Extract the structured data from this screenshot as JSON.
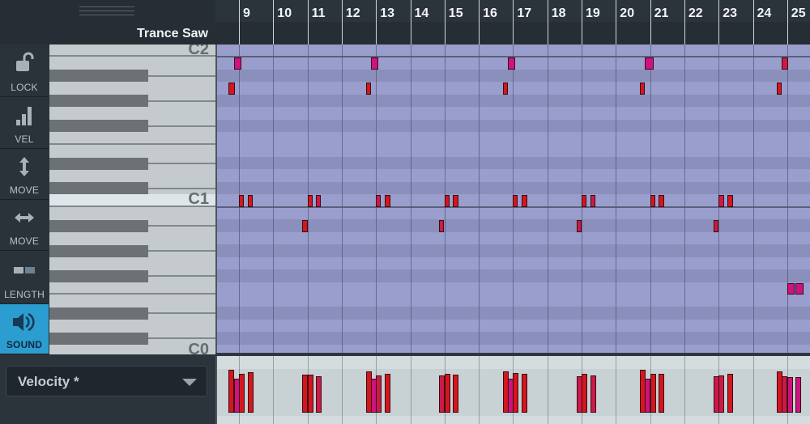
{
  "track": {
    "title": "Trance Saw"
  },
  "tools": [
    {
      "id": "lock",
      "label": "LOCK",
      "icon": "unlock-icon",
      "active": false
    },
    {
      "id": "vel",
      "label": "VEL",
      "icon": "velocity-bars-icon",
      "active": false
    },
    {
      "id": "move-v",
      "label": "MOVE",
      "icon": "vertical-arrows-icon",
      "active": false
    },
    {
      "id": "move-h",
      "label": "MOVE",
      "icon": "horizontal-arrows-icon",
      "active": false
    },
    {
      "id": "length",
      "label": "LENGTH",
      "icon": "length-icon",
      "active": false
    },
    {
      "id": "sound",
      "label": "SOUND",
      "icon": "speaker-icon",
      "active": true
    }
  ],
  "piano": {
    "octave_labels": [
      "C2",
      "C1",
      "C0"
    ]
  },
  "ruler": {
    "beats": [
      "9",
      "10",
      "11",
      "12",
      "13",
      "14",
      "15",
      "16",
      "17",
      "18",
      "19",
      "20",
      "21",
      "22",
      "23",
      "24",
      "25"
    ]
  },
  "lane_selector": {
    "value": "Velocity *"
  },
  "colors": {
    "accent": "#2b9dd0",
    "note_red": "#d4161d",
    "note_crimson": "#cc1a48",
    "note_magenta": "#cc1380",
    "grid_light": "#9a9ecd",
    "grid_dark": "#8b8fbb"
  },
  "notes": [
    {
      "beat": 8.85,
      "len": 0.22,
      "pitch": "B1",
      "color": "note_magenta",
      "vel": 0.7
    },
    {
      "beat": 8.7,
      "len": 0.18,
      "pitch": "A1",
      "color": "note_red",
      "vel": 0.88
    },
    {
      "beat": 9.0,
      "len": 0.14,
      "pitch": "C1",
      "color": "note_red",
      "vel": 0.8
    },
    {
      "beat": 9.25,
      "len": 0.16,
      "pitch": "C1",
      "color": "note_red",
      "vel": 0.83
    },
    {
      "beat": 10.85,
      "len": 0.16,
      "pitch": "A#0",
      "color": "note_red",
      "vel": 0.78
    },
    {
      "beat": 11.0,
      "len": 0.14,
      "pitch": "C1",
      "color": "note_red",
      "vel": 0.78
    },
    {
      "beat": 11.25,
      "len": 0.14,
      "pitch": "C1",
      "color": "note_crimson",
      "vel": 0.75
    },
    {
      "beat": 12.85,
      "len": 0.22,
      "pitch": "B1",
      "color": "note_magenta",
      "vel": 0.7
    },
    {
      "beat": 12.7,
      "len": 0.14,
      "pitch": "A1",
      "color": "note_red",
      "vel": 0.85
    },
    {
      "beat": 13.0,
      "len": 0.14,
      "pitch": "C1",
      "color": "note_crimson",
      "vel": 0.76
    },
    {
      "beat": 13.25,
      "len": 0.16,
      "pitch": "C1",
      "color": "note_red",
      "vel": 0.8
    },
    {
      "beat": 14.85,
      "len": 0.14,
      "pitch": "A#0",
      "color": "note_crimson",
      "vel": 0.76
    },
    {
      "beat": 15.0,
      "len": 0.14,
      "pitch": "C1",
      "color": "note_red",
      "vel": 0.8
    },
    {
      "beat": 15.25,
      "len": 0.16,
      "pitch": "C1",
      "color": "note_red",
      "vel": 0.78
    },
    {
      "beat": 16.85,
      "len": 0.2,
      "pitch": "B1",
      "color": "note_magenta",
      "vel": 0.7
    },
    {
      "beat": 16.7,
      "len": 0.12,
      "pitch": "A1",
      "color": "note_red",
      "vel": 0.85
    },
    {
      "beat": 17.0,
      "len": 0.14,
      "pitch": "C1",
      "color": "note_red",
      "vel": 0.82
    },
    {
      "beat": 17.25,
      "len": 0.16,
      "pitch": "C1",
      "color": "note_red",
      "vel": 0.8
    },
    {
      "beat": 18.85,
      "len": 0.12,
      "pitch": "A#0",
      "color": "note_crimson",
      "vel": 0.75
    },
    {
      "beat": 19.0,
      "len": 0.14,
      "pitch": "C1",
      "color": "note_red",
      "vel": 0.8
    },
    {
      "beat": 19.25,
      "len": 0.14,
      "pitch": "C1",
      "color": "note_crimson",
      "vel": 0.77
    },
    {
      "beat": 20.85,
      "len": 0.26,
      "pitch": "B1",
      "color": "note_magenta",
      "vel": 0.7
    },
    {
      "beat": 20.7,
      "len": 0.14,
      "pitch": "A1",
      "color": "note_red",
      "vel": 0.88
    },
    {
      "beat": 21.0,
      "len": 0.14,
      "pitch": "C1",
      "color": "note_red",
      "vel": 0.8
    },
    {
      "beat": 21.25,
      "len": 0.16,
      "pitch": "C1",
      "color": "note_red",
      "vel": 0.8
    },
    {
      "beat": 22.85,
      "len": 0.12,
      "pitch": "A#0",
      "color": "note_crimson",
      "vel": 0.75
    },
    {
      "beat": 23.0,
      "len": 0.16,
      "pitch": "C1",
      "color": "note_crimson",
      "vel": 0.76
    },
    {
      "beat": 23.25,
      "len": 0.16,
      "pitch": "C1",
      "color": "note_red",
      "vel": 0.8
    },
    {
      "beat": 24.85,
      "len": 0.18,
      "pitch": "B1",
      "color": "note_crimson",
      "vel": 0.75
    },
    {
      "beat": 24.7,
      "len": 0.12,
      "pitch": "A1",
      "color": "note_red",
      "vel": 0.85
    },
    {
      "beat": 25.0,
      "len": 0.22,
      "pitch": "F0",
      "color": "note_magenta",
      "vel": 0.74
    },
    {
      "beat": 25.25,
      "len": 0.22,
      "pitch": "F0",
      "color": "note_magenta",
      "vel": 0.74
    }
  ]
}
